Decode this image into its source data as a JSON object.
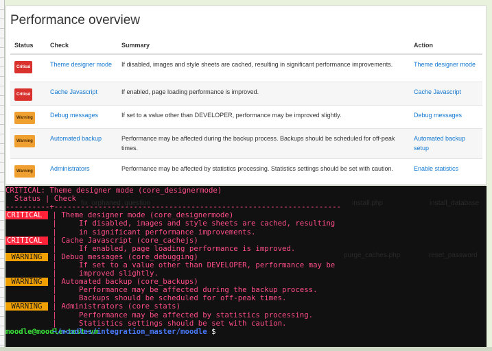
{
  "panel": {
    "title": "Performance overview",
    "headers": {
      "status": "Status",
      "check": "Check",
      "summary": "Summary",
      "action": "Action"
    },
    "rows": [
      {
        "status": "Critical",
        "level": "critical",
        "check": "Theme designer mode",
        "summary": "If disabled, images and style sheets are cached, resulting in significant performance improvements.",
        "action": "Theme designer mode"
      },
      {
        "status": "Critical",
        "level": "critical",
        "check": "Cache Javascript",
        "summary": "If enabled, page loading performance is improved.",
        "action": "Cache Javascript"
      },
      {
        "status": "Warning",
        "level": "warning",
        "check": "Debug messages",
        "summary": "If set to a value other than DEVELOPER, performance may be improved slightly.",
        "action": "Debug messages"
      },
      {
        "status": "Warning",
        "level": "warning",
        "check": "Automated backup",
        "summary": "Performance may be affected during the backup process. Backups should be scheduled for off-peak times.",
        "action": "Automated backup setup"
      },
      {
        "status": "Warning",
        "level": "warning",
        "check": "Administrators",
        "summary": "Performance may be affected by statistics processing. Statistics settings should be set with caution.",
        "action": "Enable statistics"
      }
    ]
  },
  "terminal": {
    "header_line": "CRITICAL: Theme designer mode (core_designermode)",
    "columns_line": "  Status | Check",
    "separator": "----------+-----------------------------------------------------------------",
    "entries": [
      {
        "tag": "CRITICAL",
        "level": "critical",
        "lines": [
          "Theme designer mode (core_designermode)",
          "    If disabled, images and style sheets are cached, resulting",
          "    in significant performance improvements."
        ]
      },
      {
        "tag": "CRITICAL",
        "level": "critical",
        "lines": [
          "Cache Javascript (core_cachejs)",
          "    If enabled, page loading performance is improved."
        ]
      },
      {
        "tag": " WARNING",
        "level": "warning",
        "lines": [
          "Debug messages (core_debugging)",
          "    If set to a value other than DEVELOPER, performance may be",
          "    improved slightly."
        ]
      },
      {
        "tag": " WARNING",
        "level": "warning",
        "lines": [
          "Automated backup (core_backups)",
          "    Performance may be affected during the backup process.",
          "    Backups should be scheduled for off-peak times."
        ]
      },
      {
        "tag": " WARNING",
        "level": "warning",
        "lines": [
          "Administrators (core_stats)",
          "    Performance may be affected by statistics processing.",
          "    Statistics settings should be set with caution."
        ]
      }
    ],
    "prompt_user": "moodle@moodle-test-vm",
    "prompt_path": " ~/moodles/integration_master/moodle",
    "prompt_sign": " $",
    "ghost_files": [
      "fix_orphaned_question",
      "install.php",
      "install_database",
      "purge_caches.php",
      "reset_password"
    ]
  }
}
